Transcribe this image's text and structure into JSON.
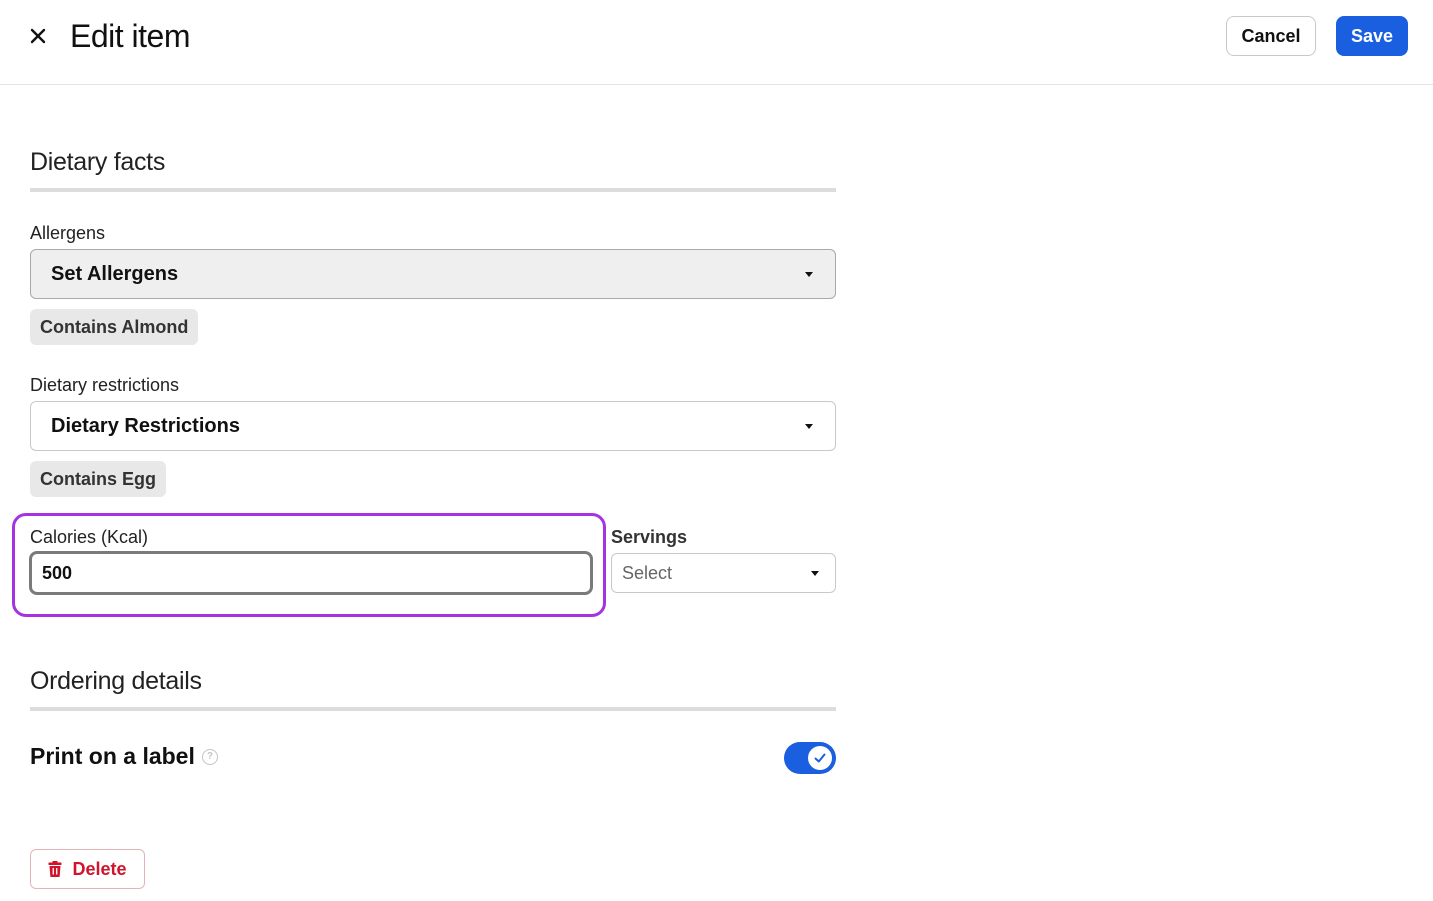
{
  "header": {
    "title": "Edit item",
    "cancel_label": "Cancel",
    "save_label": "Save"
  },
  "dietary": {
    "section_title": "Dietary facts",
    "allergens": {
      "label": "Allergens",
      "value": "Set Allergens",
      "chips": [
        "Contains Almond"
      ]
    },
    "restrictions": {
      "label": "Dietary restrictions",
      "value": "Dietary Restrictions",
      "chips": [
        "Contains Egg"
      ]
    },
    "calories": {
      "label": "Calories (Kcal)",
      "value": "500"
    },
    "servings": {
      "label": "Servings",
      "placeholder": "Select"
    }
  },
  "ordering": {
    "section_title": "Ordering details",
    "print_label": "Print on a label",
    "print_enabled": true
  },
  "footer": {
    "delete_label": "Delete"
  },
  "colors": {
    "primary": "#1a5fe0",
    "highlight": "#a433e0",
    "danger": "#d0142c"
  },
  "icons": [
    "close-icon",
    "caret-down-icon",
    "help-icon",
    "check-icon",
    "trash-icon"
  ]
}
